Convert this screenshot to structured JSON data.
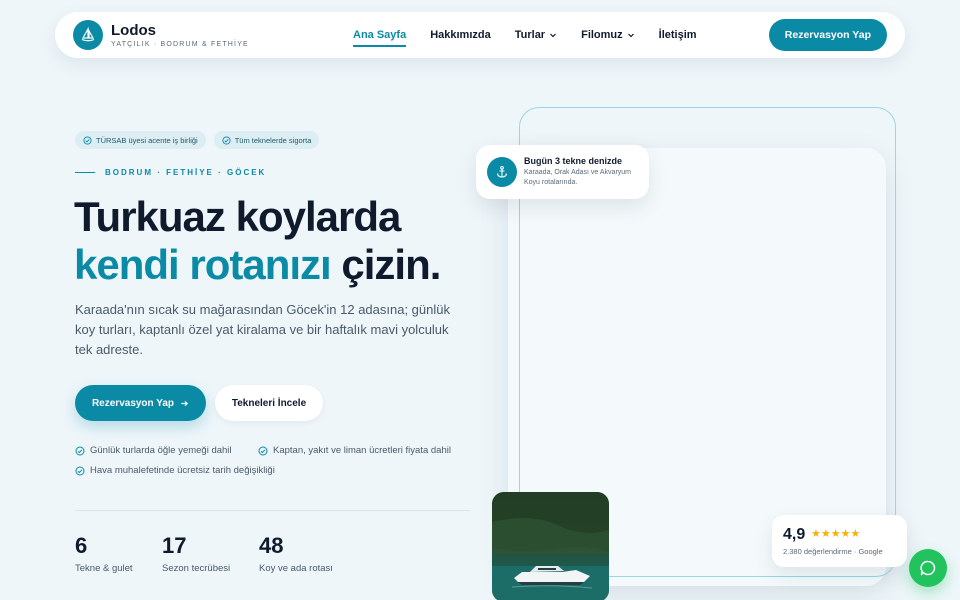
{
  "nav": {
    "brand_name": "Lodos",
    "brand_sub": "YATÇILIK · BODRUM & FETHİYE",
    "items": [
      {
        "label": "Ana Sayfa",
        "active": true,
        "dropdown": false
      },
      {
        "label": "Hakkımızda",
        "active": false,
        "dropdown": false
      },
      {
        "label": "Turlar",
        "active": false,
        "dropdown": true
      },
      {
        "label": "Filomuz",
        "active": false,
        "dropdown": true
      },
      {
        "label": "İletişim",
        "active": false,
        "dropdown": false
      }
    ],
    "cta_label": "Rezervasyon Yap"
  },
  "hero": {
    "badges": [
      "TÜRSAB üyesi acente iş birliği",
      "Tüm teknelerde sigorta"
    ],
    "eyebrow": "BODRUM · FETHİYE · GÖCEK",
    "title_line1": "Turkuaz koylarda",
    "title_accent": "kendi rotanızı",
    "title_rest": " çizin.",
    "lead": "Karaada'nın sıcak su mağarasından Göcek'in 12 adasına; günlük koy turları, kaptanlı özel yat kiralama ve bir haftalık mavi yolculuk tek adreste.",
    "primary_btn": "Rezervasyon Yap",
    "secondary_btn": "Tekneleri İncele",
    "checks": [
      "Günlük turlarda öğle yemeği dahil",
      "Kaptan, yakıt ve liman ücretleri fiyata dahil",
      "Hava muhalefetinde ücretsiz tarih değişikliği"
    ],
    "stats": [
      {
        "num": "6",
        "label": "Tekne & gulet"
      },
      {
        "num": "17",
        "label": "Sezon tecrübesi"
      },
      {
        "num": "48",
        "label": "Koy ve ada rotası"
      }
    ]
  },
  "float_card": {
    "title": "Bugün 3 tekne denizde",
    "text": "Karaada, Orak Adası ve Akvaryum Koyu rotalarında."
  },
  "rating": {
    "value": "4,9",
    "stars": "★★★★★",
    "sub": "2.380 değerlendirme · Google"
  },
  "icons": {
    "logo": "sailboat-icon",
    "float": "anchor-icon",
    "chat": "chat-icon",
    "check": "check-circle-icon"
  },
  "colors": {
    "accent": "#0b8aa6",
    "background": "#eef6fa",
    "chat": "#22c25f",
    "star": "#f5b300"
  }
}
